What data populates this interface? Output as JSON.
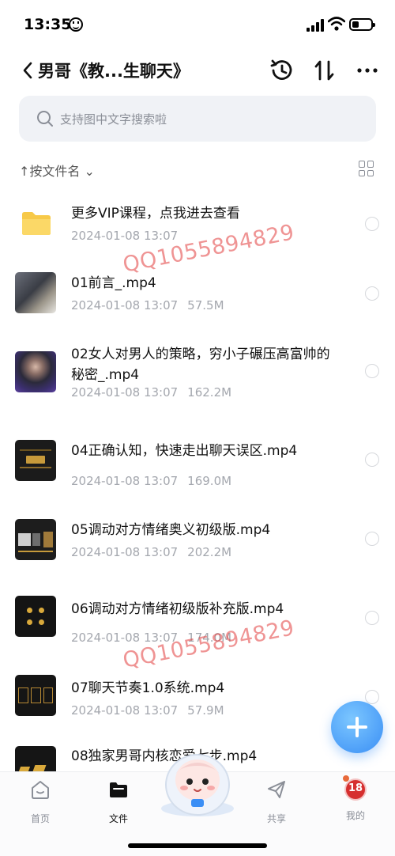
{
  "status": {
    "time": "13:35"
  },
  "header": {
    "title": "男哥《教...生聊天》"
  },
  "search": {
    "placeholder": "支持图中文字搜索啦"
  },
  "sort": {
    "label": "↑按文件名 ⌄"
  },
  "files": [
    {
      "name": "更多VIP课程，点我进去查看",
      "date": "2024-01-08 13:07",
      "size": "",
      "type": "folder"
    },
    {
      "name": "01前言_.mp4",
      "date": "2024-01-08 13:07",
      "size": "57.5M",
      "type": "video"
    },
    {
      "name": "02女人对男人的策略，穷小子碾压高富帅的秘密_.mp4",
      "date": "2024-01-08 13:07",
      "size": "162.2M",
      "type": "video"
    },
    {
      "name": "04正确认知，快速走出聊天误区.mp4",
      "date": "2024-01-08 13:07",
      "size": "169.0M",
      "type": "video"
    },
    {
      "name": "05调动对方情绪奥义初级版.mp4",
      "date": "2024-01-08 13:07",
      "size": "202.2M",
      "type": "video"
    },
    {
      "name": "06调动对方情绪初级版补充版.mp4",
      "date": "2024-01-08 13:07",
      "size": "174.0M",
      "type": "video"
    },
    {
      "name": "07聊天节奏1.0系统.mp4",
      "date": "2024-01-08 13:07",
      "size": "57.9M",
      "type": "video"
    },
    {
      "name": "08独家男哥内核恋爱七步.mp4",
      "date": "",
      "size": "",
      "type": "video"
    }
  ],
  "watermark": {
    "text": "QQ1055894829"
  },
  "tabs": [
    {
      "label": "首页",
      "icon": "home-icon"
    },
    {
      "label": "文件",
      "icon": "folder-icon"
    },
    {
      "label": "共享",
      "icon": "share-icon"
    },
    {
      "label": "我的",
      "icon": "profile-icon"
    }
  ],
  "profile_badge": "18",
  "colors": {
    "accent": "#3a8ef5",
    "watermark": "#e13c3c",
    "folder": "#f7c948"
  }
}
